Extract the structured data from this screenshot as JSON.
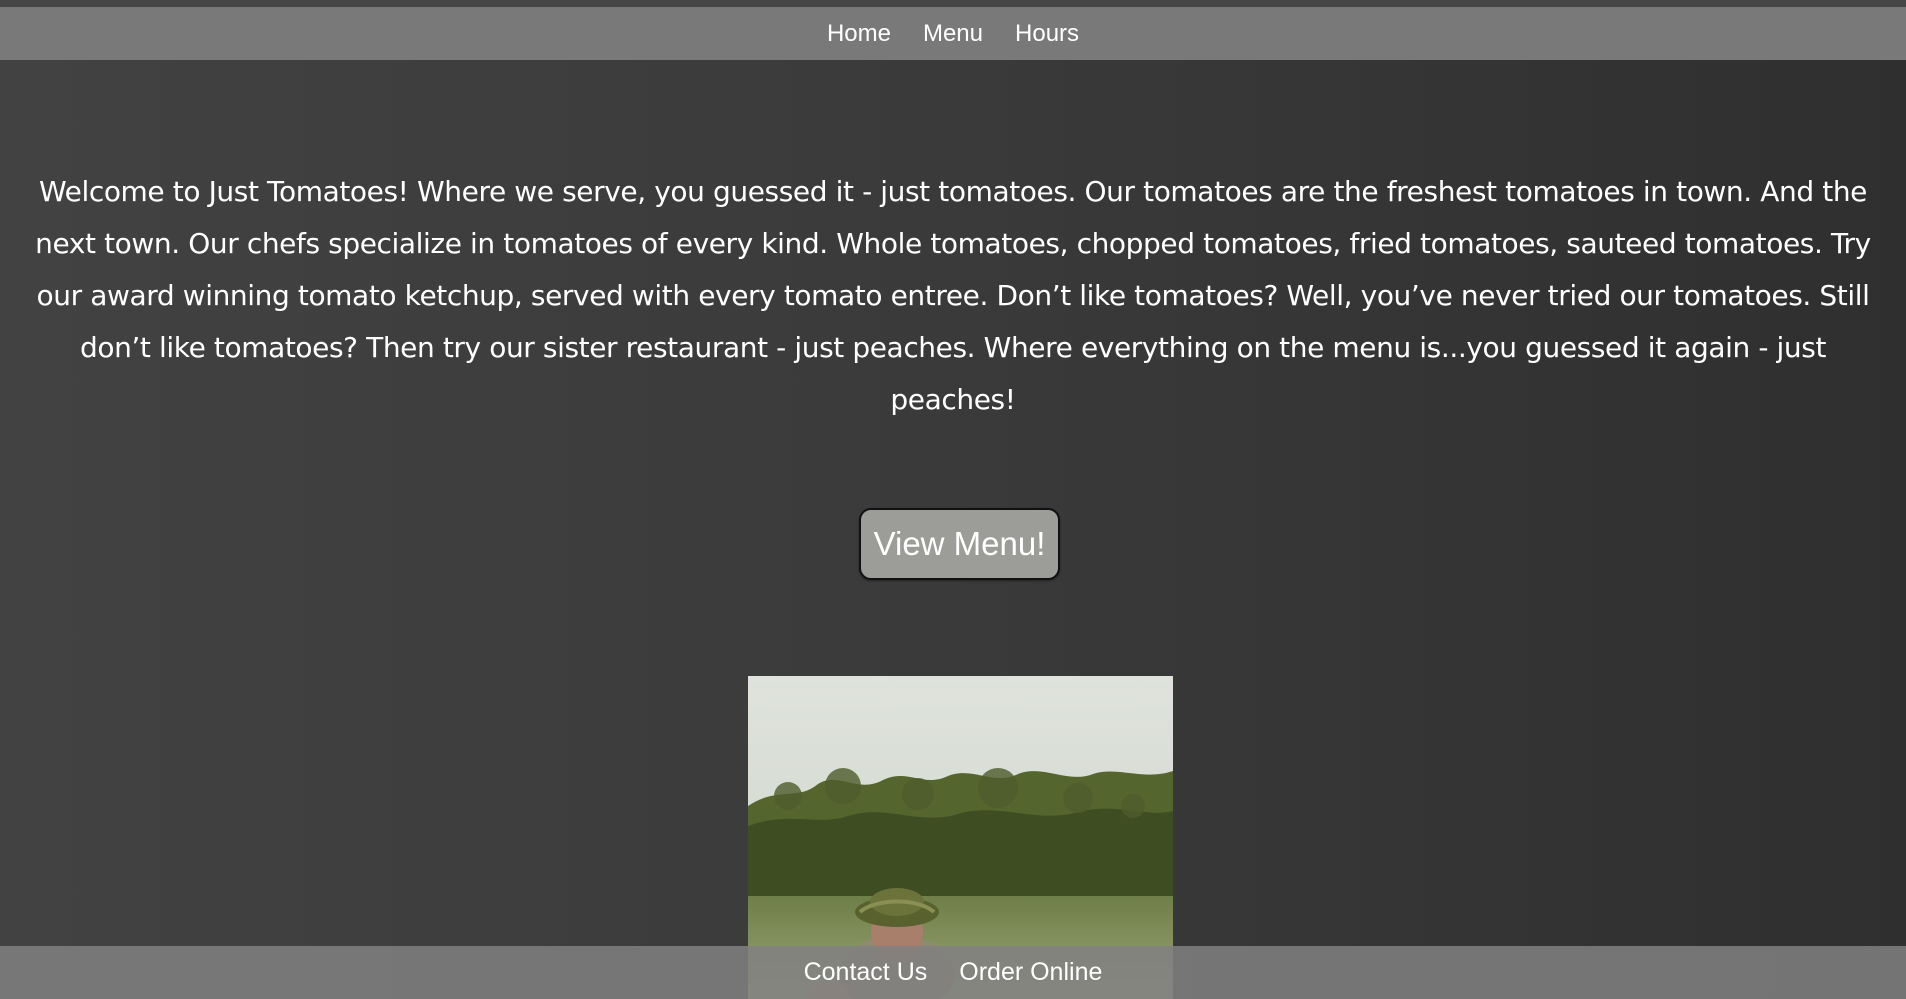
{
  "nav": {
    "items": [
      {
        "label": "Home"
      },
      {
        "label": "Menu"
      },
      {
        "label": "Hours"
      }
    ]
  },
  "intro": {
    "text": "Welcome to Just Tomatoes! Where we serve, you guessed it - just tomatoes. Our tomatoes are the freshest tomatoes in town. And the next town. Our chefs specialize in tomatoes of every kind. Whole tomatoes, chopped tomatoes, fried tomatoes, sauteed tomatoes. Try our award winning tomato ketchup, served with every tomato entree. Don’t like tomatoes? Well, you’ve never tried our tomatoes. Still don’t like tomatoes? Then try our sister restaurant - just peaches. Where everything on the menu is...you guessed it again - just peaches!"
  },
  "cta": {
    "label": "View Menu!"
  },
  "photo": {
    "icon": "farmer-photo"
  },
  "footer": {
    "items": [
      {
        "label": "Contact Us"
      },
      {
        "label": "Order Online"
      }
    ]
  },
  "colors": {
    "background": "#3a3a3a",
    "nav_bar": "#797979",
    "button": "#9c9c98",
    "text": "#ffffff"
  }
}
